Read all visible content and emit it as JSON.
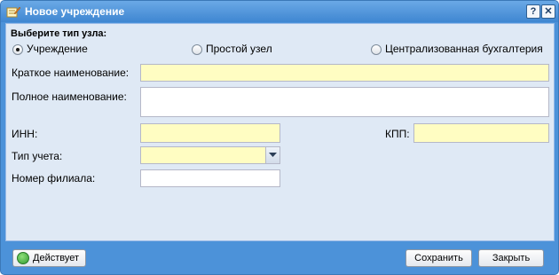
{
  "window": {
    "title": "Новое учреждение",
    "help_glyph": "?",
    "close_glyph": "✕",
    "icons": {
      "title": "edit-note-icon",
      "help": "help-icon",
      "close": "close-icon"
    }
  },
  "node_type": {
    "label": "Выберите тип узла:",
    "options": [
      "Учреждение",
      "Простой узел",
      "Централизованная бухгалтерия"
    ],
    "selected": "Учреждение"
  },
  "form": {
    "short_name_label": "Краткое наименование:",
    "full_name_label": "Полное наименование:",
    "inn_label": "ИНН:",
    "kpp_label": "КПП:",
    "accounting_type_label": "Тип учета:",
    "branch_number_label": "Номер филиала:",
    "values": {
      "short_name": "",
      "full_name": "",
      "inn": "",
      "kpp": "",
      "accounting_type": "",
      "branch_number": ""
    }
  },
  "footer": {
    "status_label": "Действует",
    "save_label": "Сохранить",
    "close_label": "Закрыть"
  },
  "colors": {
    "title_bar": "#4c92d9",
    "form_background": "#dfe9f5",
    "required_field": "#fffdc2"
  }
}
